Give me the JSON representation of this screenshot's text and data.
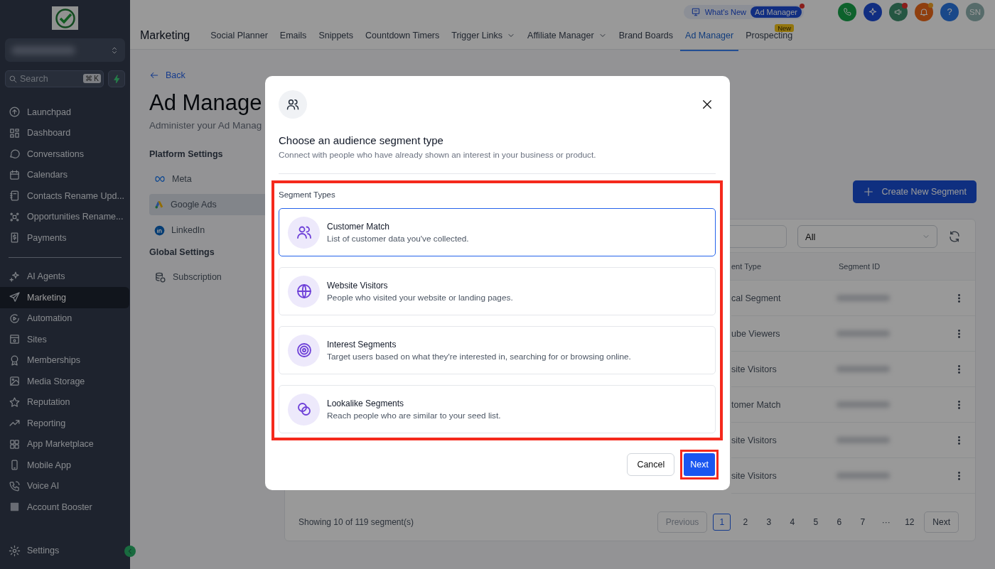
{
  "sidebar": {
    "search": {
      "placeholder": "Search",
      "shortcut": "⌘ K"
    },
    "nav_groups": [
      [
        {
          "label": "Launchpad",
          "selected": false
        },
        {
          "label": "Dashboard",
          "selected": false
        },
        {
          "label": "Conversations",
          "selected": false
        },
        {
          "label": "Calendars",
          "selected": false
        },
        {
          "label": "Contacts Rename Upd...",
          "selected": false
        },
        {
          "label": "Opportunities Rename...",
          "selected": false
        },
        {
          "label": "Payments",
          "selected": false
        }
      ],
      [
        {
          "label": "AI Agents",
          "selected": false
        },
        {
          "label": "Marketing",
          "selected": true
        },
        {
          "label": "Automation",
          "selected": false
        },
        {
          "label": "Sites",
          "selected": false
        },
        {
          "label": "Memberships",
          "selected": false
        },
        {
          "label": "Media Storage",
          "selected": false
        },
        {
          "label": "Reputation",
          "selected": false
        },
        {
          "label": "Reporting",
          "selected": false
        },
        {
          "label": "App Marketplace",
          "selected": false
        },
        {
          "label": "Mobile App",
          "selected": false
        },
        {
          "label": "Voice AI",
          "selected": false
        },
        {
          "label": "Account Booster",
          "selected": false
        }
      ]
    ],
    "settings": "Settings"
  },
  "top_bar": {
    "whats_new": "What's New",
    "whats_new_badge": "Ad Manager",
    "help": "?",
    "avatar": "SN",
    "section_title": "Marketing",
    "tabs": [
      {
        "label": "Social Planner",
        "selected": false,
        "dropdown": false
      },
      {
        "label": "Emails",
        "selected": false,
        "dropdown": false
      },
      {
        "label": "Snippets",
        "selected": false,
        "dropdown": false
      },
      {
        "label": "Countdown Timers",
        "selected": false,
        "dropdown": false
      },
      {
        "label": "Trigger Links",
        "selected": false,
        "dropdown": true
      },
      {
        "label": "Affiliate Manager",
        "selected": false,
        "dropdown": true
      },
      {
        "label": "Brand Boards",
        "selected": false,
        "dropdown": false
      },
      {
        "label": "Ad Manager",
        "selected": true,
        "dropdown": false
      },
      {
        "label": "Prospecting",
        "selected": false,
        "dropdown": false,
        "badge": "New"
      }
    ]
  },
  "page": {
    "back": "Back",
    "title": "Ad Manage",
    "subtitle": "Administer your Ad Manag",
    "settings_groups": [
      {
        "heading": "Platform Settings",
        "items": [
          {
            "label": "Meta",
            "selected": false
          },
          {
            "label": "Google Ads",
            "selected": true
          },
          {
            "label": "LinkedIn",
            "selected": false
          }
        ]
      },
      {
        "heading": "Global Settings",
        "items": [
          {
            "label": "Subscription",
            "selected": false
          }
        ]
      }
    ],
    "create_button": "Create New Segment",
    "table": {
      "filter": "All",
      "columns": [
        "ent Type",
        "Segment ID"
      ],
      "rows": [
        {
          "type": "cal Segment"
        },
        {
          "type": "ube Viewers"
        },
        {
          "type": "site Visitors"
        },
        {
          "type": "tomer Match"
        },
        {
          "type": "site Visitors"
        },
        {
          "type": "site Visitors"
        }
      ],
      "summary": "Showing 10 of 119 segment(s)",
      "pagination": {
        "previous": "Previous",
        "next": "Next",
        "pages": [
          {
            "label": "1",
            "selected": true
          },
          {
            "label": "2",
            "selected": false
          },
          {
            "label": "3",
            "selected": false
          },
          {
            "label": "4",
            "selected": false
          },
          {
            "label": "5",
            "selected": false
          },
          {
            "label": "6",
            "selected": false
          },
          {
            "label": "7",
            "selected": false
          },
          {
            "label": "···",
            "selected": false
          },
          {
            "label": "12",
            "selected": false
          }
        ]
      }
    }
  },
  "modal": {
    "title": "Choose an audience segment type",
    "subtitle": "Connect with people who have already shown an interest in your business or product.",
    "section_label": "Segment Types",
    "options": [
      {
        "title": "Customer Match",
        "description": "List of customer data you've collected.",
        "selected": true
      },
      {
        "title": "Website Visitors",
        "description": "People who visited your website or landing pages.",
        "selected": false
      },
      {
        "title": "Interest Segments",
        "description": "Target users based on what they're interested in, searching for or browsing online.",
        "selected": false
      },
      {
        "title": "Lookalike Segments",
        "description": "Reach people who are similar to your seed list.",
        "selected": false
      }
    ],
    "cancel": "Cancel",
    "next": "Next"
  }
}
